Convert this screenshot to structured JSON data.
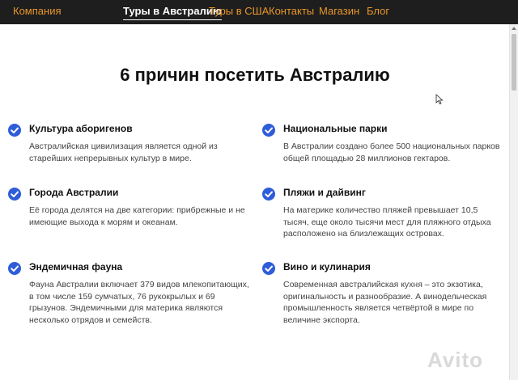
{
  "nav": {
    "brand": "Компания",
    "items": [
      {
        "label": "Туры в Австралию",
        "active": true
      },
      {
        "label": "Туры в США",
        "active": false
      },
      {
        "label": "Контакты",
        "active": false
      },
      {
        "label": "Магазин",
        "active": false
      },
      {
        "label": "Блог",
        "active": false
      }
    ]
  },
  "page": {
    "title": "6 причин посетить Австралию"
  },
  "features": [
    {
      "title": "Культура аборигенов",
      "description": "Австралийская цивилизация является одной из старейших непрерывных культур в мире.",
      "icon": "check-circle-icon"
    },
    {
      "title": "Национальные парки",
      "description": "В Австралии создано более 500 национальных парков общей площадью 28 миллионов гектаров.",
      "icon": "check-circle-icon"
    },
    {
      "title": "Города Австралии",
      "description": "Её города делятся на две категории: прибрежные и не имеющие выхода к морям и океанам.",
      "icon": "check-circle-icon"
    },
    {
      "title": "Пляжи и дайвинг",
      "description": "На материке количество пляжей превышает 10,5 тысяч, еще около тысячи мест для пляжного отдыха расположено на близлежащих островах.",
      "icon": "check-circle-icon"
    },
    {
      "title": "Эндемичная фауна",
      "description": "Фауна Австралии включает 379 видов млекопитающих, в том числе 159 сумчатых, 76 рукокрылых и 69 грызунов. Эндемичными для материка являются несколько отрядов и семейств.",
      "icon": "check-circle-icon"
    },
    {
      "title": "Вино и кулинария",
      "description": "Современная австралийская кухня – это экзотика, оригинальность и разнообразие. А винодельческая промышленность является четвёртой в мире по величине экспорта.",
      "icon": "check-circle-icon"
    }
  ],
  "watermark": "Avito",
  "colors": {
    "nav_bg": "#1e1e1e",
    "nav_link": "#e8962a",
    "check": "#2f5dd9"
  }
}
